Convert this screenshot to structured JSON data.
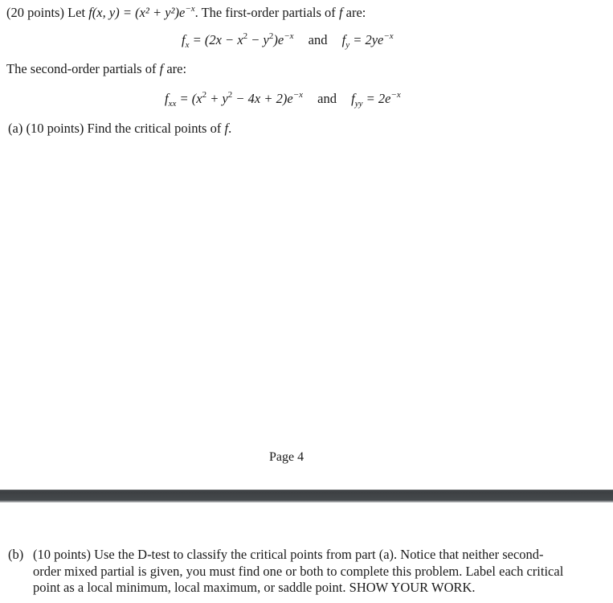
{
  "problem": {
    "intro": {
      "points": "(20 points)",
      "lead": "Let",
      "function_def": "f(x, y) = (x² + y²)e",
      "exp": "−x",
      "tail": ". The first-order partials of",
      "f": "f",
      "end": "are:"
    },
    "first_order": {
      "fx_lhs": "f",
      "fx_sub": "x",
      "fx_rhs_a": " = (2x − x",
      "sq1": "2",
      "fx_rhs_b": " − y",
      "sq2": "2",
      "fx_rhs_c": ")e",
      "fx_exp": "−x",
      "and": "and",
      "fy_lhs": "f",
      "fy_sub": "y",
      "fy_rhs": " = 2ye",
      "fy_exp": "−x"
    },
    "second_intro": {
      "text": "The second-order partials of",
      "f": "f",
      "end": "are:"
    },
    "second_order": {
      "fxx_lhs": "f",
      "fxx_sub": "xx",
      "fxx_rhs_a": " = (x",
      "sq1": "2",
      "fxx_rhs_b": " + y",
      "sq2": "2",
      "fxx_rhs_c": " − 4x + 2)e",
      "fxx_exp": "−x",
      "and": "and",
      "fyy_lhs": "f",
      "fyy_sub": "yy",
      "fyy_rhs": " = 2e",
      "fyy_exp": "−x"
    },
    "part_a": {
      "label": "(a)",
      "text": "(10 points) Find the critical points of",
      "f": "f",
      "end": "."
    },
    "page_number": "Page 4",
    "part_b": {
      "label": "(b)",
      "lines": [
        "(10 points) Use the D-test to classify the critical points from part (a). Notice that neither second-",
        "order mixed partial is given, you must find one or both to complete this problem. Label each critical",
        "point as a local minimum, local maximum, or saddle point. SHOW YOUR WORK."
      ]
    }
  }
}
